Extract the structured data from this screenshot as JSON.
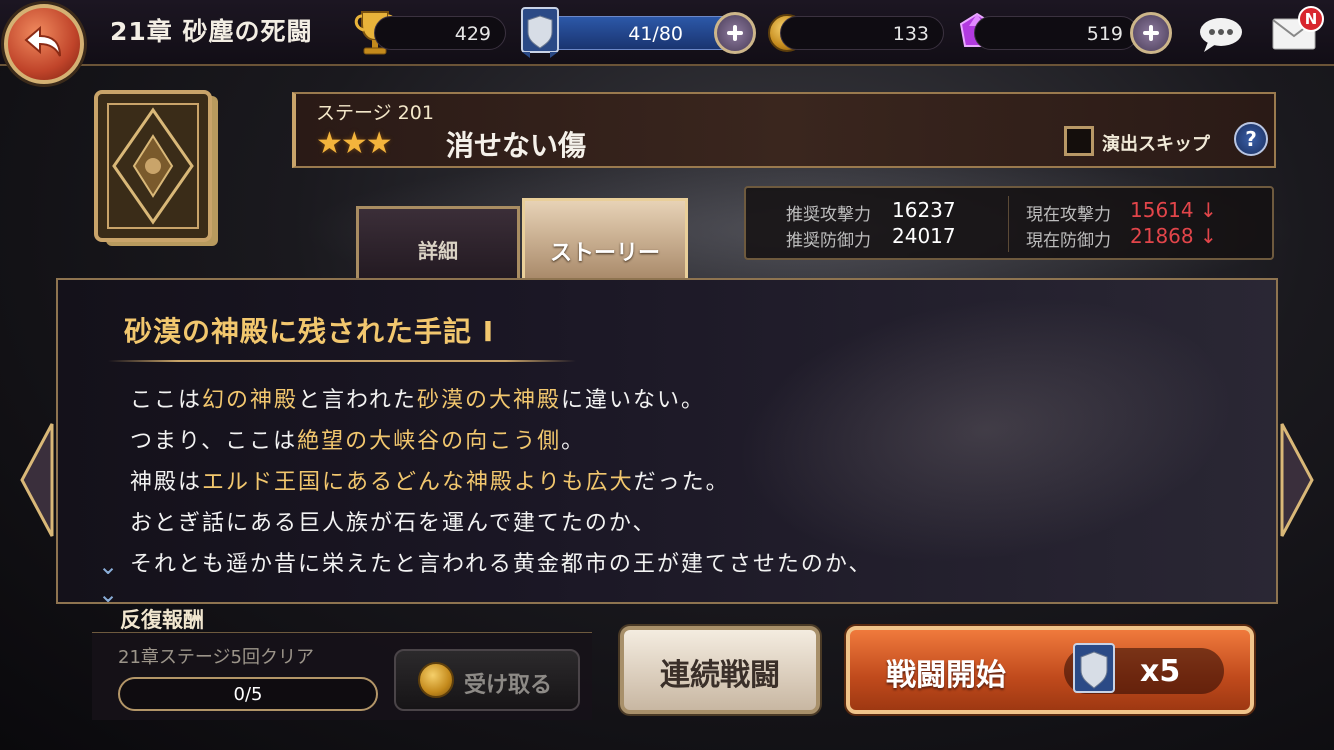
{
  "topbar": {
    "chapter_title": "21章 砂塵の死闘",
    "trophy_count": "429",
    "stamina": "41/80",
    "coins": "133",
    "gems": "519",
    "mail_badge": "N"
  },
  "stage": {
    "label": "ステージ 201",
    "stars": "★★★",
    "name": "消せない傷",
    "skip_label": "演出スキップ",
    "help": "?"
  },
  "stats": {
    "rec_attack_label": "推奨攻撃力",
    "rec_attack": "16237",
    "rec_defense_label": "推奨防御力",
    "rec_defense": "24017",
    "cur_attack_label": "現在攻撃力",
    "cur_attack": "15614 ↓",
    "cur_defense_label": "現在防御力",
    "cur_defense": "21868 ↓"
  },
  "tabs": {
    "detail": "詳細",
    "story": "ストーリー"
  },
  "story": {
    "title": "砂漠の神殿に残された手記 I",
    "lines": [
      [
        {
          "t": "ここは",
          "h": false
        },
        {
          "t": "幻の神殿",
          "h": true
        },
        {
          "t": "と言われた",
          "h": false
        },
        {
          "t": "砂漠の大神殿",
          "h": true
        },
        {
          "t": "に違いない。",
          "h": false
        }
      ],
      [
        {
          "t": "つまり、ここは",
          "h": false
        },
        {
          "t": "絶望の大峡谷の向こう側",
          "h": true
        },
        {
          "t": "。",
          "h": false
        }
      ],
      [
        {
          "t": "神殿は",
          "h": false
        },
        {
          "t": "エルド王国にあるどんな神殿よりも広大",
          "h": true
        },
        {
          "t": "だった。",
          "h": false
        }
      ],
      [
        {
          "t": "おとぎ話にある巨人族が石を運んで建てたのか、",
          "h": false
        }
      ],
      [
        {
          "t": "それとも遥か昔に栄えたと言われる黄金都市の王が建てさせたのか、",
          "h": false
        }
      ]
    ]
  },
  "reward": {
    "title": "反復報酬",
    "condition": "21章ステージ5回クリア",
    "progress_text": "0/5",
    "progress_fraction": 0,
    "receive_label": "受け取る"
  },
  "buttons": {
    "auto_battle": "連続戦闘",
    "start_battle": "戦闘開始",
    "cost": "x5"
  }
}
